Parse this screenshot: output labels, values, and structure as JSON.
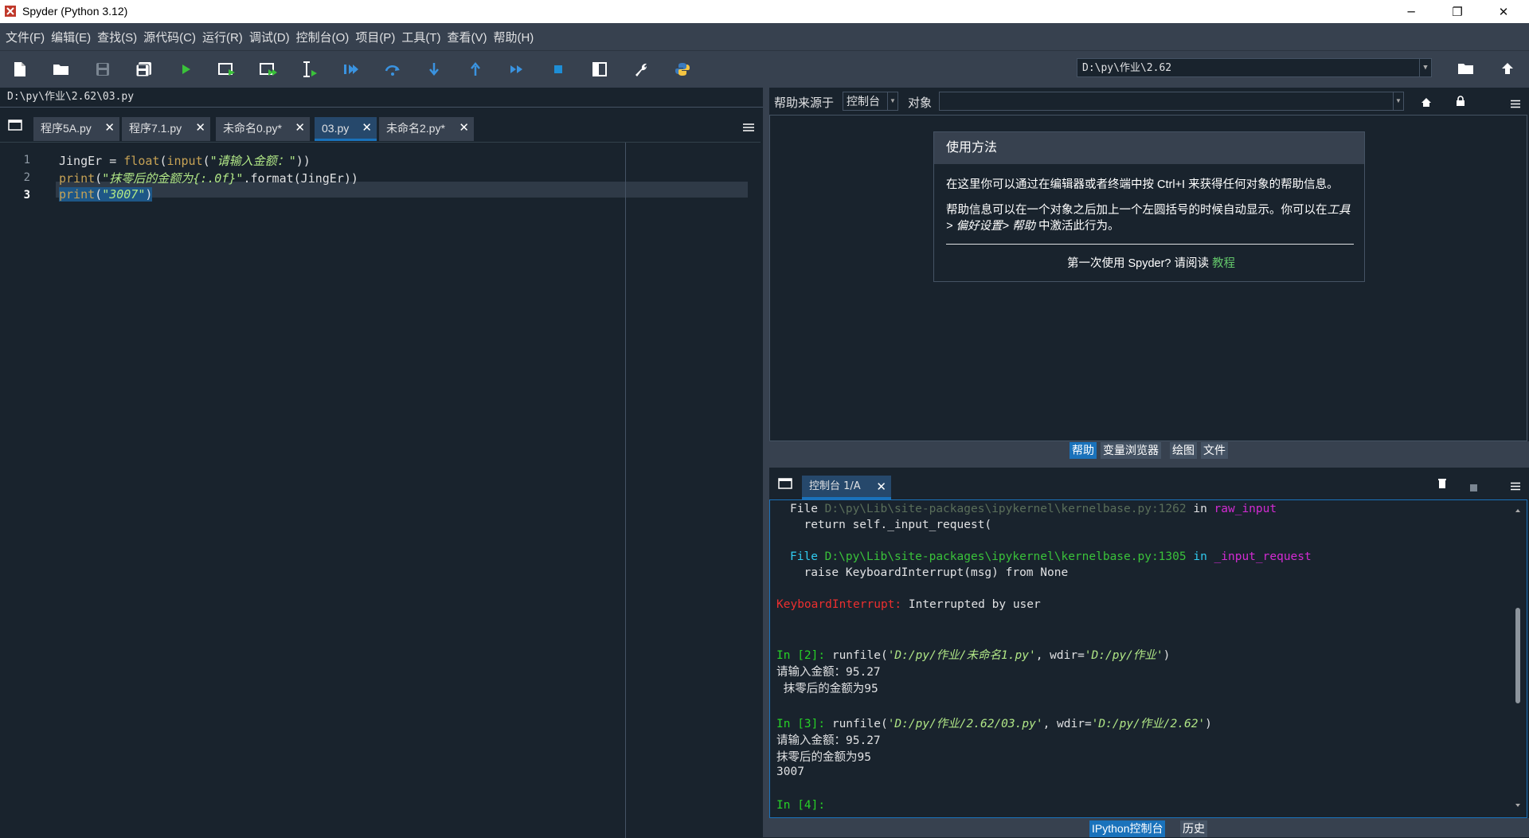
{
  "window": {
    "title": "Spyder (Python 3.12)",
    "controls": [
      "─",
      "❐",
      "✕"
    ]
  },
  "menu": [
    "文件(F)",
    "编辑(E)",
    "查找(S)",
    "源代码(C)",
    "运行(R)",
    "调试(D)",
    "控制台(O)",
    "项目(P)",
    "工具(T)",
    "查看(V)",
    "帮助(H)"
  ],
  "toolbar": {
    "icons": [
      "new-file-icon",
      "open-folder-icon",
      "save-icon",
      "save-all-icon",
      "run-icon",
      "run-cell-icon",
      "run-cell-advance-icon",
      "run-selection-icon",
      "debug-icon",
      "step-over-icon",
      "step-into-icon",
      "step-return-icon",
      "continue-icon",
      "stop-icon",
      "maximize-pane-icon",
      "wrench-icon",
      "python-path-icon"
    ],
    "working_dir": "D:\\py\\作业\\2.62",
    "colors": {
      "accent": "#1a72bb",
      "run": "#3ac23a"
    }
  },
  "editor": {
    "file_path": "D:\\py\\作业\\2.62\\03.py",
    "tabs": [
      {
        "label": "程序5A.py",
        "active": false
      },
      {
        "label": "程序7.1.py",
        "active": false
      },
      {
        "label": "未命名0.py*",
        "active": false
      },
      {
        "label": "03.py",
        "active": true
      },
      {
        "label": "未命名2.py*",
        "active": false
      }
    ],
    "line_numbers": [
      "1",
      "2",
      "3"
    ],
    "lines": [
      {
        "a": "JingEr = ",
        "b": "float",
        "c": "(",
        "d": "input",
        "e": "(",
        "f": "\"请输入金额：\"",
        "g": "))"
      },
      {
        "a": "",
        "b": "print",
        "c": "(",
        "f": "\"抹零后的金额为{:.0f}\"",
        "g": ".format(JingEr))"
      },
      {
        "b": "print",
        "c": "(",
        "f": "\"3007\"",
        "g": ")"
      }
    ]
  },
  "help": {
    "source_label": "帮助来源于",
    "source_value": "控制台",
    "object_label": "对象",
    "object_value": "",
    "card_title": "使用方法",
    "para1": "在这里你可以通过在编辑器或者终端中按 Ctrl+I 来获得任何对象的帮助信息。",
    "para2a": "帮助信息可以在一个对象之后加上一个左圆括号的时候自动显示。你可以在",
    "para2b_italic": "工具> 偏好设置> 帮助",
    "para2c": " 中激活此行为。",
    "footer_text": "第一次使用 Spyder? 请阅读 ",
    "footer_link": "教程",
    "pane_tabs": [
      "帮助",
      "变量浏览器",
      "绘图",
      "文件"
    ]
  },
  "console": {
    "tab_label": "控制台 1/A",
    "bottom_tabs": [
      "IPython控制台",
      "历史"
    ],
    "lines": {
      "l1_file": "File ",
      "l1_path": "D:\\py\\Lib\\site-packages\\ipykernel\\kernelbase.py:1262",
      "l1_in": " in ",
      "l1_fn": "raw_input",
      "l2": "  return self._input_request(",
      "l3_file": "File ",
      "l3_path": "D:\\py\\Lib\\site-packages\\ipykernel\\kernelbase.py:1305",
      "l3_in": " in ",
      "l3_fn": "_input_request",
      "l4": "  raise KeyboardInterrupt(msg) from None",
      "l5_err": "KeyboardInterrupt:",
      "l5_msg": " Interrupted by user",
      "in2_prompt": "In [2]:",
      "in2_cmd": " runfile(",
      "in2_arg1": "'D:/py/作业/未命名1.py'",
      "in2_mid": ", wdir=",
      "in2_arg2": "'D:/py/作业'",
      "in2_end": ")",
      "o2a": "请输入金额：95.27",
      "o2b": " 抹零后的金额为95",
      "in3_prompt": "In [3]:",
      "in3_cmd": " runfile(",
      "in3_arg1": "'D:/py/作业/2.62/03.py'",
      "in3_mid": ", wdir=",
      "in3_arg2": "'D:/py/作业/2.62'",
      "in3_end": ")",
      "o3a": "请输入金额：95.27",
      "o3b": "抹零后的金额为95",
      "o3c": "3007",
      "in4_prompt": "In [4]:"
    }
  }
}
